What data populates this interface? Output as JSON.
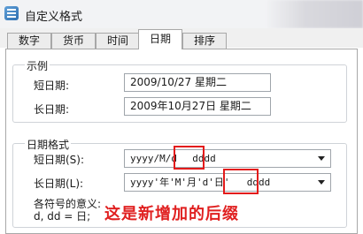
{
  "window": {
    "title": "自定义格式",
    "icon": "settings-app-icon"
  },
  "tabs": [
    {
      "label": "数字"
    },
    {
      "label": "货币"
    },
    {
      "label": "时间"
    },
    {
      "label": "日期",
      "active": true
    },
    {
      "label": "排序"
    }
  ],
  "example": {
    "legend": "示例",
    "short_label": "短日期:",
    "short_value": "2009/10/27 星期二",
    "long_label": "长日期:",
    "long_value": "2009年10月27日 星期二"
  },
  "date_format": {
    "legend": "日期格式",
    "short_label": "短日期(S):",
    "short_value": "yyyy/M/d",
    "short_suffix": "dddd",
    "long_label": "长日期(L):",
    "long_value": "yyyy'年'M'月'd'日'",
    "long_suffix": "dddd",
    "symbols_label": "各符号的意义:",
    "symbols_row": "d, dd = 日;"
  },
  "annotation": "这是新增加的后缀",
  "colors": {
    "highlight": "#e31b1b"
  }
}
